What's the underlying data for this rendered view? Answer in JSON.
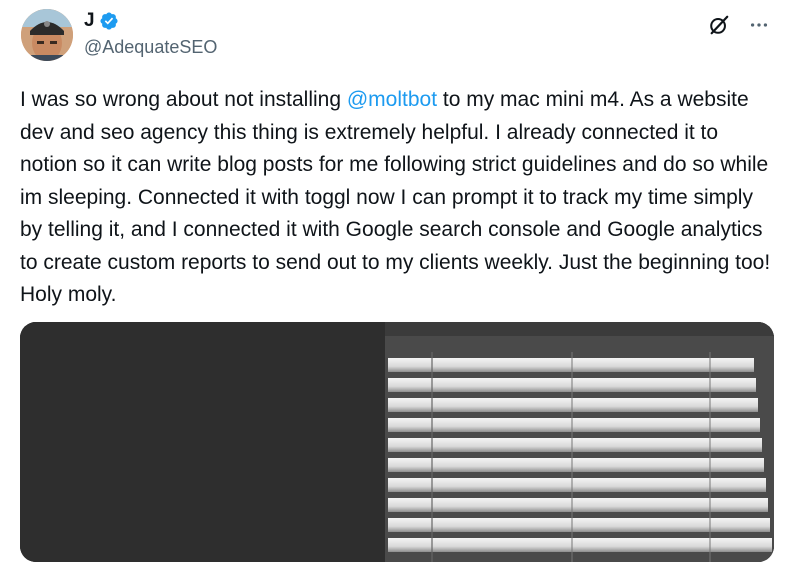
{
  "author": {
    "display_name": "J",
    "handle": "@AdequateSEO",
    "verified": true,
    "avatar_icon": "avatar-image"
  },
  "actions": {
    "grok_icon": "grok-icon",
    "more_icon": "more-options-icon"
  },
  "tweet": {
    "text_before": "I was so wrong about not installing ",
    "mention": "@moltbot",
    "text_after": " to my mac mini m4. As a website dev and seo agency this thing is extremely helpful. I already connected it to notion so it can write blog posts for me following strict guidelines and do so while im sleeping. Connected it with toggl now I can prompt it to track my time simply by telling it, and I connected it with Google search console and Google analytics to create custom reports to send out to my clients weekly. Just the beginning too! Holy moly."
  },
  "colors": {
    "text": "#0f1419",
    "secondary": "#536471",
    "link": "#1d9bf0",
    "verified": "#1d9bf0"
  },
  "media": {
    "icon": "window-blinds-photo"
  }
}
